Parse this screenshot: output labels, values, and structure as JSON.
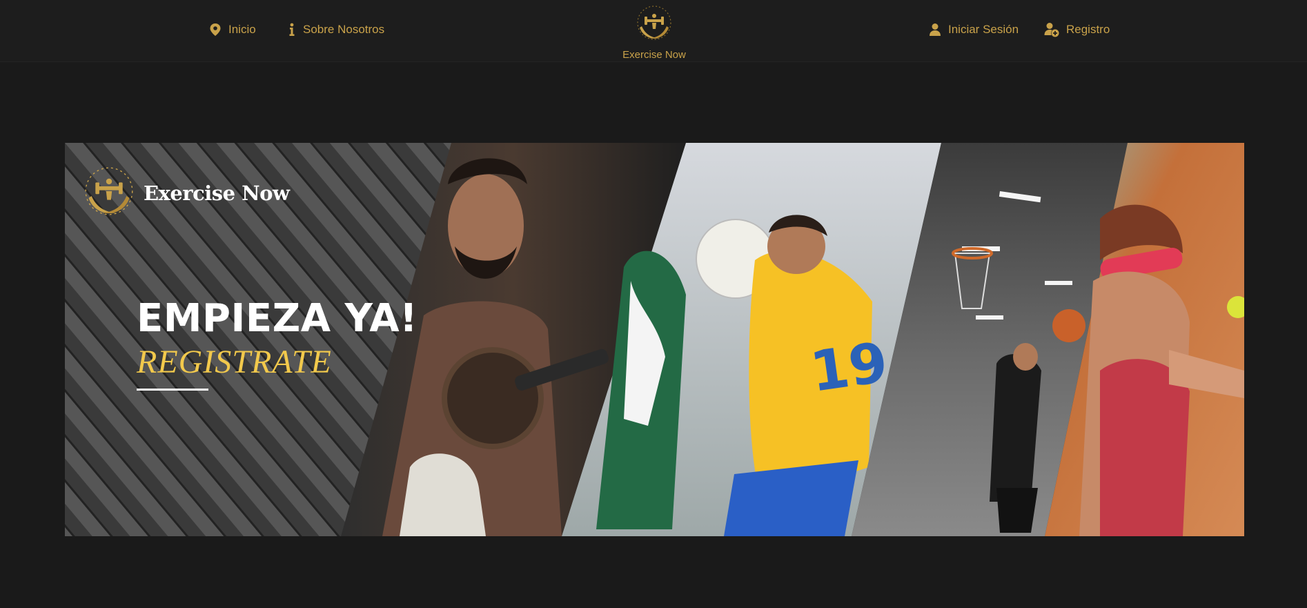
{
  "nav": {
    "inicio": "Inicio",
    "sobre_nosotros": "Sobre Nosotros",
    "brand": "Exercise Now",
    "iniciar_sesion": "Iniciar Sesión",
    "registro": "Registro"
  },
  "banner": {
    "brand": "Exercise Now",
    "headline": "EMPIEZA YA!",
    "subheadline": "REGISTRATE"
  },
  "colors": {
    "background": "#1a1a1a",
    "nav_gold": "#c9a24a",
    "headline_white": "#ffffff",
    "subheadline_gold": "#f2c94c"
  },
  "icons": {
    "inicio": "map-pin-icon",
    "sobre_nosotros": "info-icon",
    "iniciar_sesion": "user-icon",
    "registro": "user-plus-icon"
  }
}
